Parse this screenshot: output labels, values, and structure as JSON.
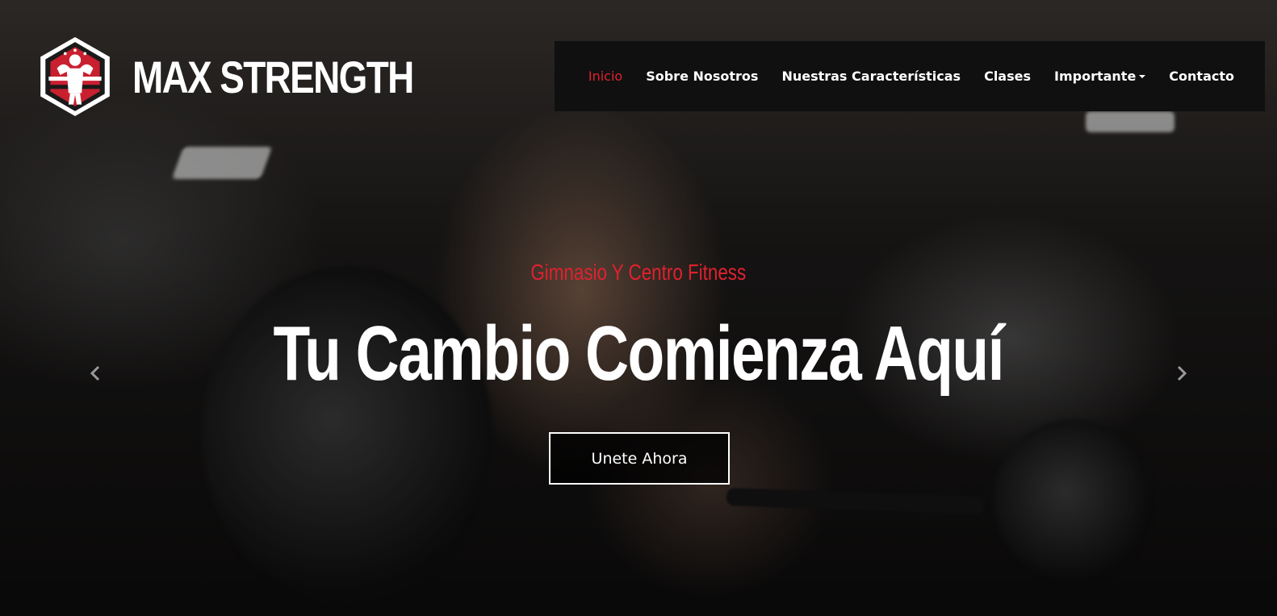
{
  "brand": {
    "name": "MAX STRENGTH",
    "logo_icon": "bodybuilder-shield-logo",
    "logo_colors": {
      "red": "#c8202f",
      "dark": "#1a1a1a",
      "white": "#ffffff"
    }
  },
  "nav": {
    "items": [
      {
        "label": "Inicio",
        "active": true
      },
      {
        "label": "Sobre Nosotros",
        "active": false
      },
      {
        "label": "Nuestras Características",
        "active": false
      },
      {
        "label": "Clases",
        "active": false
      },
      {
        "label": "Importante",
        "active": false,
        "dropdown": true
      },
      {
        "label": "Contacto",
        "active": false
      }
    ],
    "background": "#101010",
    "active_color": "#e0212f"
  },
  "hero": {
    "subtitle": "Gimnasio Y Centro Fitness",
    "title": "Tu Cambio Comienza Aquí",
    "cta_label": "Unete Ahora",
    "prev_icon": "chevron-left-icon",
    "next_icon": "chevron-right-icon",
    "accent_color": "#e0212f"
  }
}
